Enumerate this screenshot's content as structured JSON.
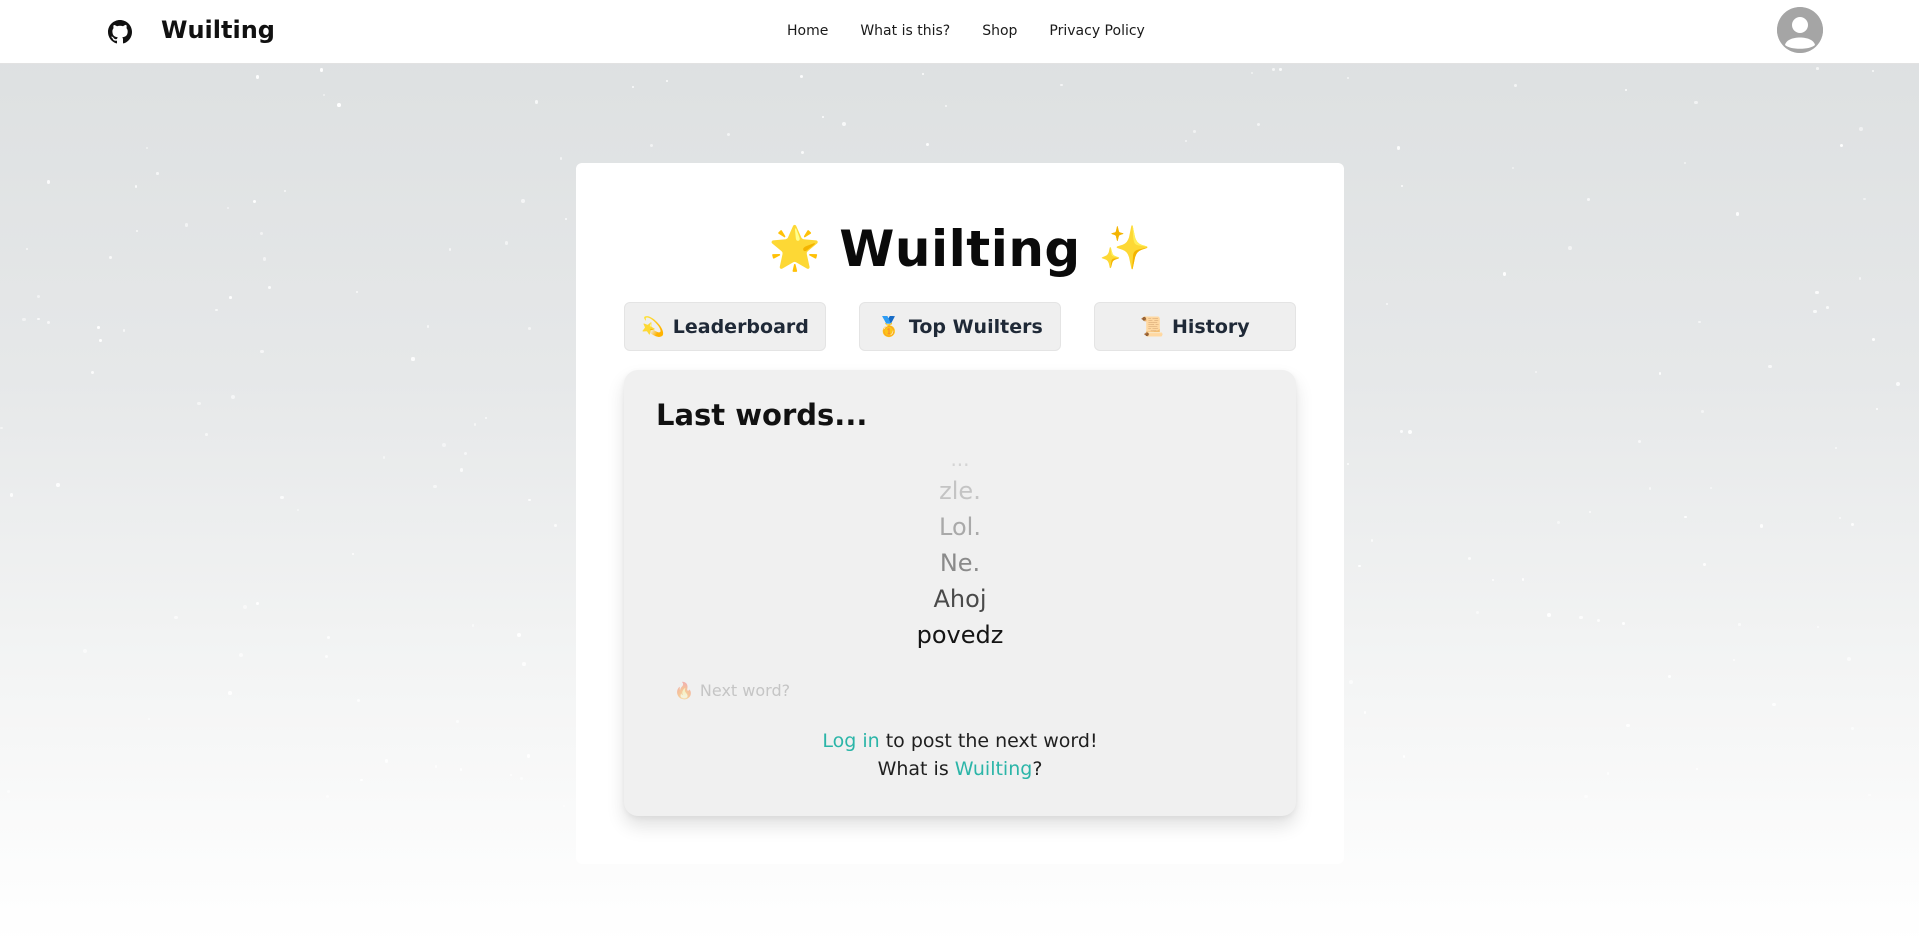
{
  "navbar": {
    "brand": "Wuilting",
    "links": [
      "Home",
      "What is this?",
      "Shop",
      "Privacy Policy"
    ]
  },
  "card": {
    "title": "Wuilting",
    "title_emoji_left": "🌟",
    "title_emoji_right": "✨",
    "tabs": [
      {
        "emoji": "💫",
        "label": "Leaderboard"
      },
      {
        "emoji": "🥇",
        "label": "Top Wuilters"
      },
      {
        "emoji": "📜",
        "label": "History"
      }
    ]
  },
  "panel": {
    "title": "Last words...",
    "words": [
      "...",
      "zle.",
      "Lol.",
      "Ne.",
      "Ahoj",
      "povedz"
    ],
    "next_word_emoji": "🔥",
    "next_word_placeholder": "Next word?",
    "login_link": "Log in",
    "login_rest": " to post the next word!",
    "what_is_prefix": "What is ",
    "what_is_link": "Wuilting",
    "what_is_suffix": "?"
  },
  "colors": {
    "accent": "#2bb5a8",
    "word_shades": [
      "#d4d4d4",
      "#c4c4c4",
      "#a9a9a9",
      "#8a8a8a",
      "#4a4a4a",
      "#141414"
    ]
  }
}
